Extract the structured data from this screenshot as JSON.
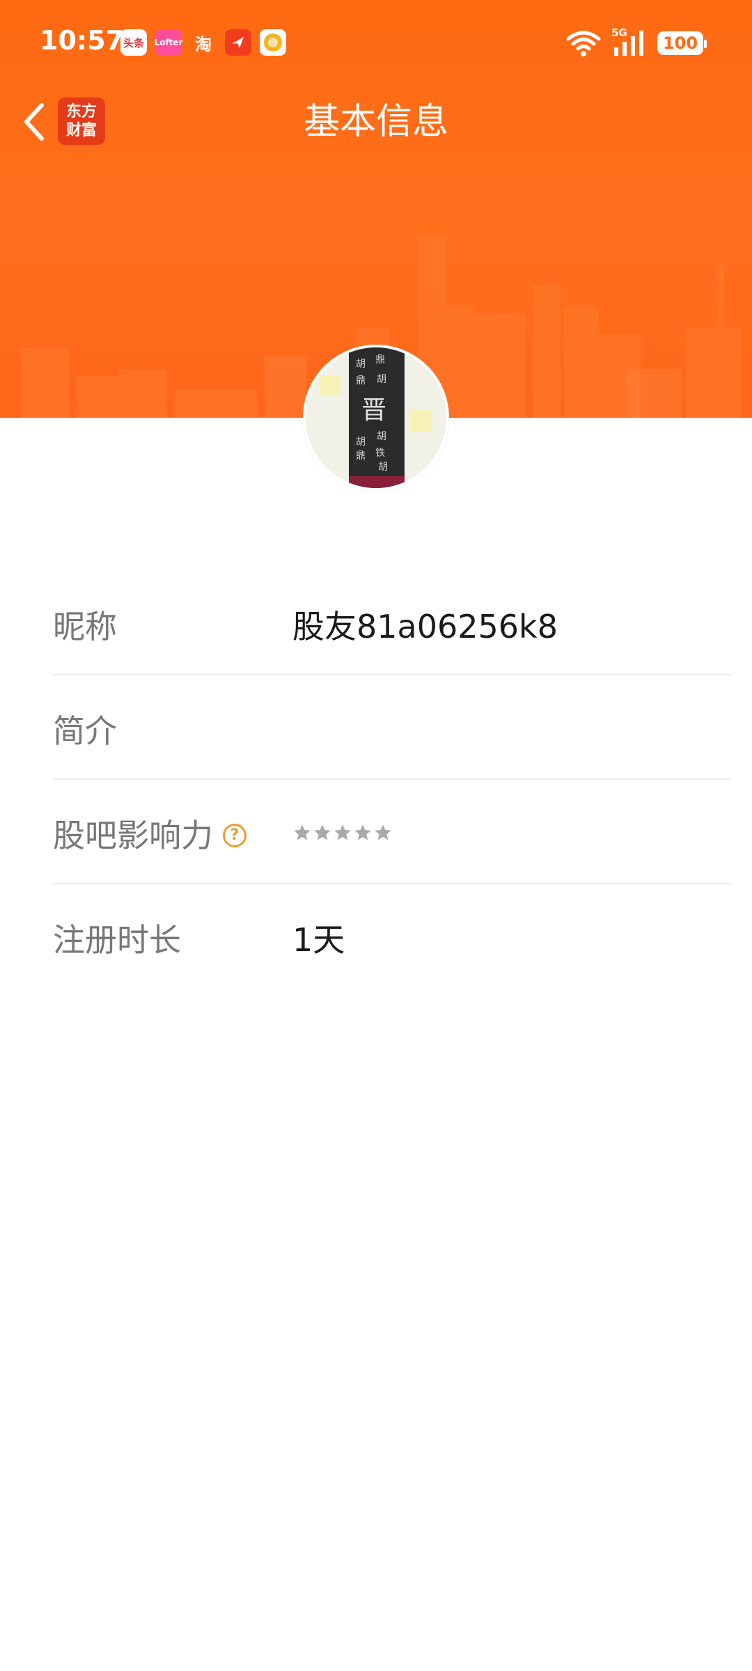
{
  "status_bar": {
    "time": "10:57",
    "notification_icons": [
      "toutiao-icon",
      "lofter-icon",
      "taobao-icon",
      "feishu-icon",
      "fruit-app-icon"
    ],
    "notif_labels": {
      "toutiao": "头条",
      "pink": "Lofter",
      "taobao": "淘"
    },
    "network": "5G",
    "battery": "100"
  },
  "nav": {
    "title": "基本信息",
    "app_logo_line1": "东方",
    "app_logo_line2": "财富"
  },
  "profile": {
    "avatar_icon": "avatar-image",
    "rows": [
      {
        "label": "昵称",
        "value": "股友81a06256k8"
      },
      {
        "label": "简介",
        "value": ""
      },
      {
        "label": "股吧影响力",
        "help": "?",
        "stars_total": 5,
        "stars_filled": 0
      },
      {
        "label": "注册时长",
        "value": "1天"
      }
    ]
  },
  "colors": {
    "banner": "#ff6a12",
    "star": "#a9a9a9",
    "help_accent": "#f39a2c"
  }
}
